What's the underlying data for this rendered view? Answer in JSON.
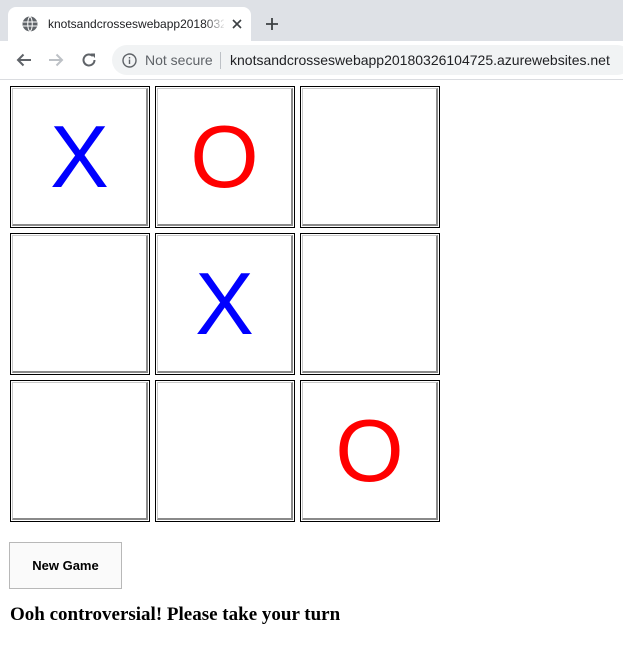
{
  "browser": {
    "tab_title": "knotsandcrosseswebapp20180326104725",
    "security_label": "Not secure",
    "url": "knotsandcrosseswebapp20180326104725.azurewebsites.net"
  },
  "board": {
    "cells": [
      {
        "mark": "X"
      },
      {
        "mark": "O"
      },
      {
        "mark": ""
      },
      {
        "mark": ""
      },
      {
        "mark": "X"
      },
      {
        "mark": ""
      },
      {
        "mark": ""
      },
      {
        "mark": ""
      },
      {
        "mark": "O"
      }
    ]
  },
  "colors": {
    "X": "#0000ff",
    "O": "#ff0000"
  },
  "controls": {
    "new_game_label": "New Game"
  },
  "status_text": "Ooh controversial! Please take your turn"
}
